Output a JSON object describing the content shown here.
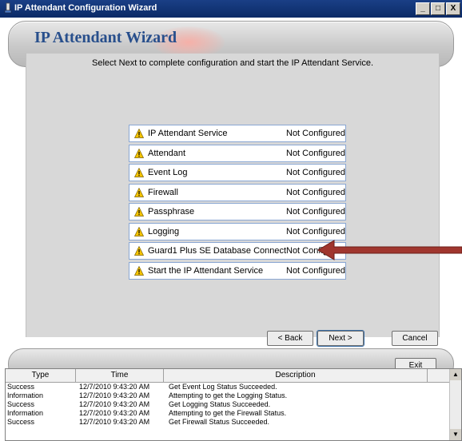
{
  "window": {
    "title": "IP Attendant Configuration Wizard",
    "minimize_glyph": "_",
    "maximize_glyph": "□",
    "close_glyph": "X"
  },
  "wizard": {
    "heading": "IP Attendant Wizard",
    "instruction": "Select Next to complete configuration and start the IP Attendant Service."
  },
  "status_items": [
    {
      "name": "IP Attendant Service",
      "status": "Not Configured",
      "icon": "warning-icon"
    },
    {
      "name": "Attendant",
      "status": "Not Configured",
      "icon": "warning-icon"
    },
    {
      "name": "Event Log",
      "status": "Not Configured",
      "icon": "warning-icon"
    },
    {
      "name": "Firewall",
      "status": "Not Configured",
      "icon": "warning-icon"
    },
    {
      "name": "Passphrase",
      "status": "Not Configured",
      "icon": "warning-icon"
    },
    {
      "name": "Logging",
      "status": "Not Configured",
      "icon": "warning-icon"
    },
    {
      "name": "Guard1 Plus SE Database Connection",
      "status": "Not Configured",
      "icon": "warning-icon"
    },
    {
      "name": "Start the IP Attendant Service",
      "status": "Not Configured",
      "icon": "warning-icon"
    }
  ],
  "buttons": {
    "back": "< Back",
    "next": "Next >",
    "cancel": "Cancel",
    "exit": "Exit"
  },
  "log": {
    "columns": [
      "Type",
      "Time",
      "Description"
    ],
    "rows": [
      {
        "type": "Success",
        "time": "12/7/2010 9:43:20 AM",
        "description": "Get Event Log Status Succeeded."
      },
      {
        "type": "Information",
        "time": "12/7/2010 9:43:20 AM",
        "description": "Attempting to get the Logging Status."
      },
      {
        "type": "Success",
        "time": "12/7/2010 9:43:20 AM",
        "description": "Get Logging Status Succeeded."
      },
      {
        "type": "Information",
        "time": "12/7/2010 9:43:20 AM",
        "description": "Attempting to get the Firewall Status."
      },
      {
        "type": "Success",
        "time": "12/7/2010 9:43:20 AM",
        "description": "Get Firewall Status Succeeded."
      }
    ]
  },
  "colors": {
    "title_bar": "#0b2a66",
    "heading": "#284f8c",
    "warning": "#f5c400",
    "annotation_arrow": "#a0362e"
  }
}
